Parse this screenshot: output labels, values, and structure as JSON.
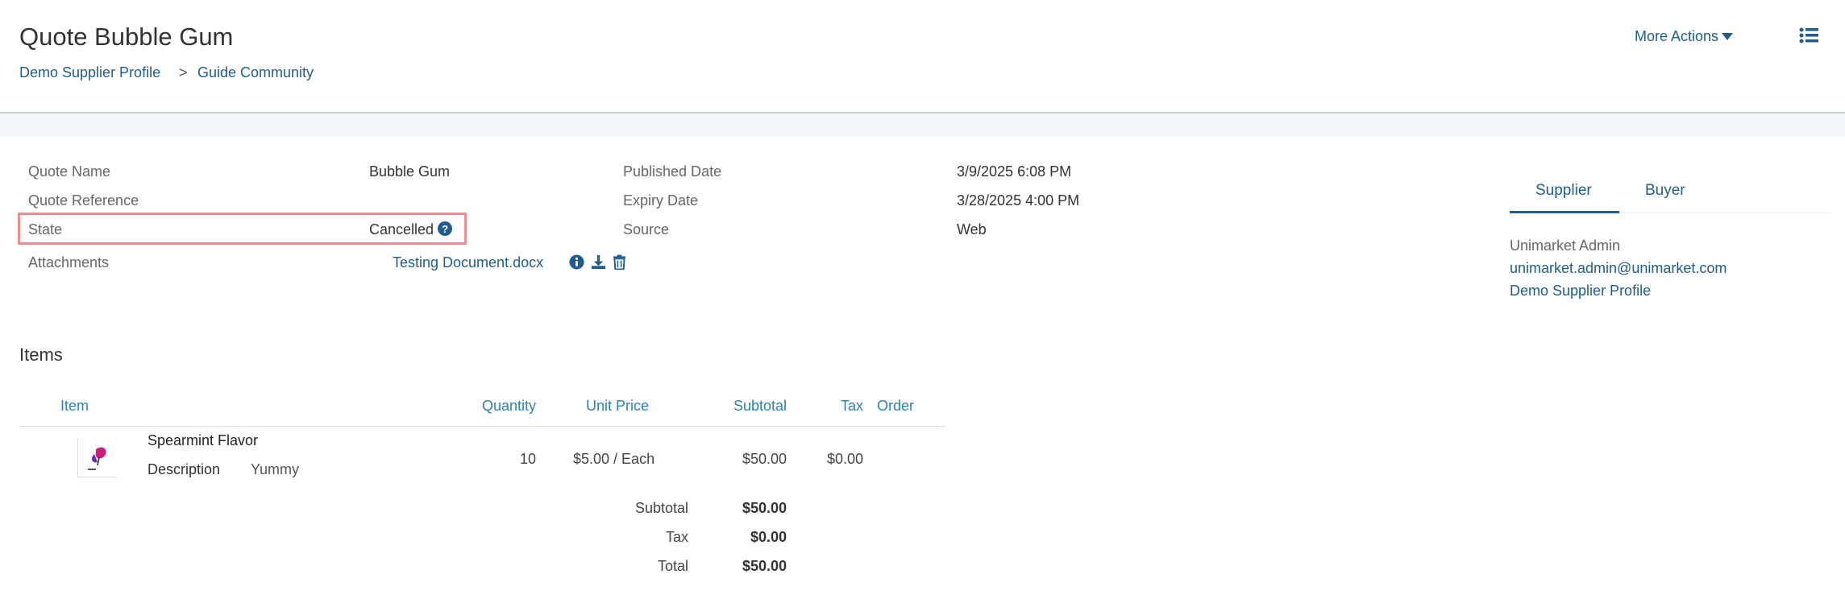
{
  "header": {
    "title": "Quote Bubble Gum",
    "breadcrumb": [
      "Demo Supplier Profile",
      "Guide Community"
    ],
    "breadcrumb_separator": ">",
    "more_actions_label": "More Actions",
    "list_icon": "list-icon"
  },
  "details": {
    "quote_name_label": "Quote Name",
    "quote_name_value": "Bubble Gum",
    "quote_reference_label": "Quote Reference",
    "quote_reference_value": "",
    "state_label": "State",
    "state_value": "Cancelled",
    "attachments_label": "Attachments",
    "attachment_name": "Testing Document.docx",
    "published_date_label": "Published Date",
    "published_date_value": "3/9/2025 6:08 PM",
    "expiry_date_label": "Expiry Date",
    "expiry_date_value": "3/28/2025 4:00 PM",
    "source_label": "Source",
    "source_value": "Web"
  },
  "contact_tabs": {
    "tabs": [
      "Supplier",
      "Buyer"
    ],
    "active": "Supplier",
    "name": "Unimarket Admin",
    "email": "unimarket.admin@unimarket.com",
    "profile": "Demo Supplier Profile"
  },
  "items": {
    "title": "Items",
    "columns": [
      "Item",
      "Quantity",
      "Unit Price",
      "Subtotal",
      "Tax",
      "Order"
    ],
    "rows": [
      {
        "name": "Spearmint Flavor",
        "description_label": "Description",
        "description_value": "Yummy",
        "quantity": "10",
        "unit_price": "$5.00 / Each",
        "subtotal": "$50.00",
        "tax": "$0.00",
        "order": ""
      }
    ],
    "totals": {
      "subtotal_label": "Subtotal",
      "subtotal_value": "$50.00",
      "tax_label": "Tax",
      "tax_value": "$0.00",
      "total_label": "Total",
      "total_value": "$50.00"
    }
  },
  "colors": {
    "link": "#1f5c8f",
    "header_column": "#2a83b5",
    "highlight_border": "#f08b92"
  }
}
